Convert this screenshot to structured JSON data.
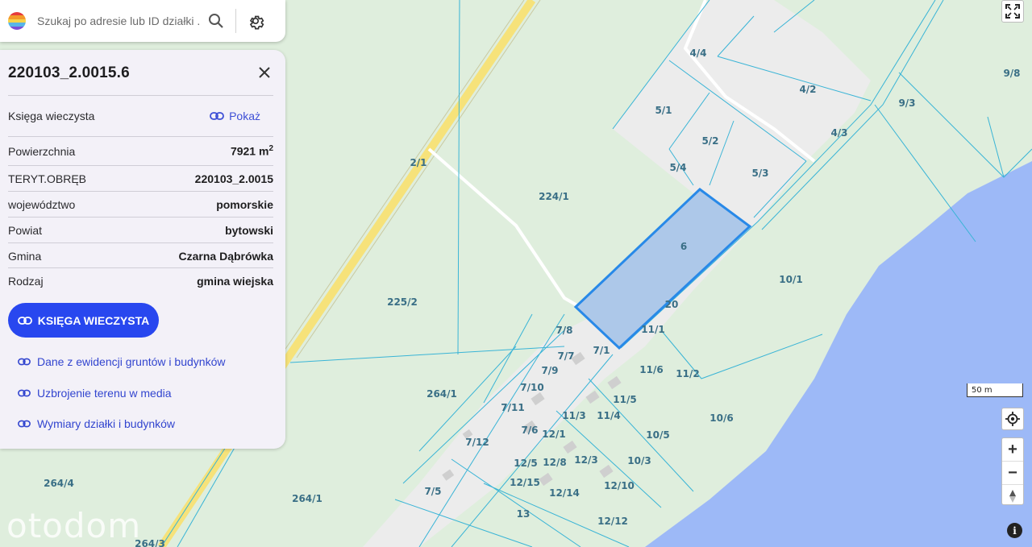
{
  "search": {
    "placeholder": "Szukaj po adresie lub ID działki ..."
  },
  "panel": {
    "title": "220103_2.0015.6",
    "land_register_label": "Księga wieczysta",
    "show_link": "Pokaż",
    "rows": [
      {
        "label": "Powierzchnia",
        "value": "7921 m",
        "sup": "2"
      },
      {
        "label": "TERYT.OBRĘB",
        "value": "220103_2.0015"
      },
      {
        "label": "województwo",
        "value": "pomorskie"
      },
      {
        "label": "Powiat",
        "value": "bytowski"
      },
      {
        "label": "Gmina",
        "value": "Czarna Dąbrówka"
      },
      {
        "label": "Rodzaj",
        "value": "gmina wiejska"
      }
    ],
    "primary_button": "KSIĘGA WIECZYSTA",
    "links": [
      "Dane z ewidencji gruntów i budynków",
      "Uzbrojenie terenu w media",
      "Wymiary działki i budynków"
    ]
  },
  "map": {
    "scale": "50 m",
    "watermark": "otodom",
    "colors": {
      "land": "#dfeedd",
      "water": "#9db9f7",
      "parcel_line": "#39b4d6",
      "selected_fill": "#adc8e9",
      "selected_stroke": "#2889e8",
      "road": "#f6e27a"
    },
    "parcels": [
      "4/4",
      "4/2",
      "9/8",
      "9/3",
      "5/1",
      "5/2",
      "4/3",
      "5/4",
      "5/3",
      "2/1",
      "224/1",
      "6",
      "10/1",
      "225/2",
      "20",
      "7/8",
      "11/1",
      "7/7",
      "7/1",
      "7/9",
      "11/6",
      "11/2",
      "7/10",
      "11/5",
      "264/1",
      "7/11",
      "11/4",
      "11/3",
      "10/6",
      "7/6",
      "12/1",
      "10/5",
      "7/12",
      "12/5",
      "12/8",
      "12/3",
      "10/3",
      "12/15",
      "12/14",
      "12/10",
      "264/4",
      "7/5",
      "264/1",
      "13",
      "12/12",
      "264/3"
    ]
  }
}
